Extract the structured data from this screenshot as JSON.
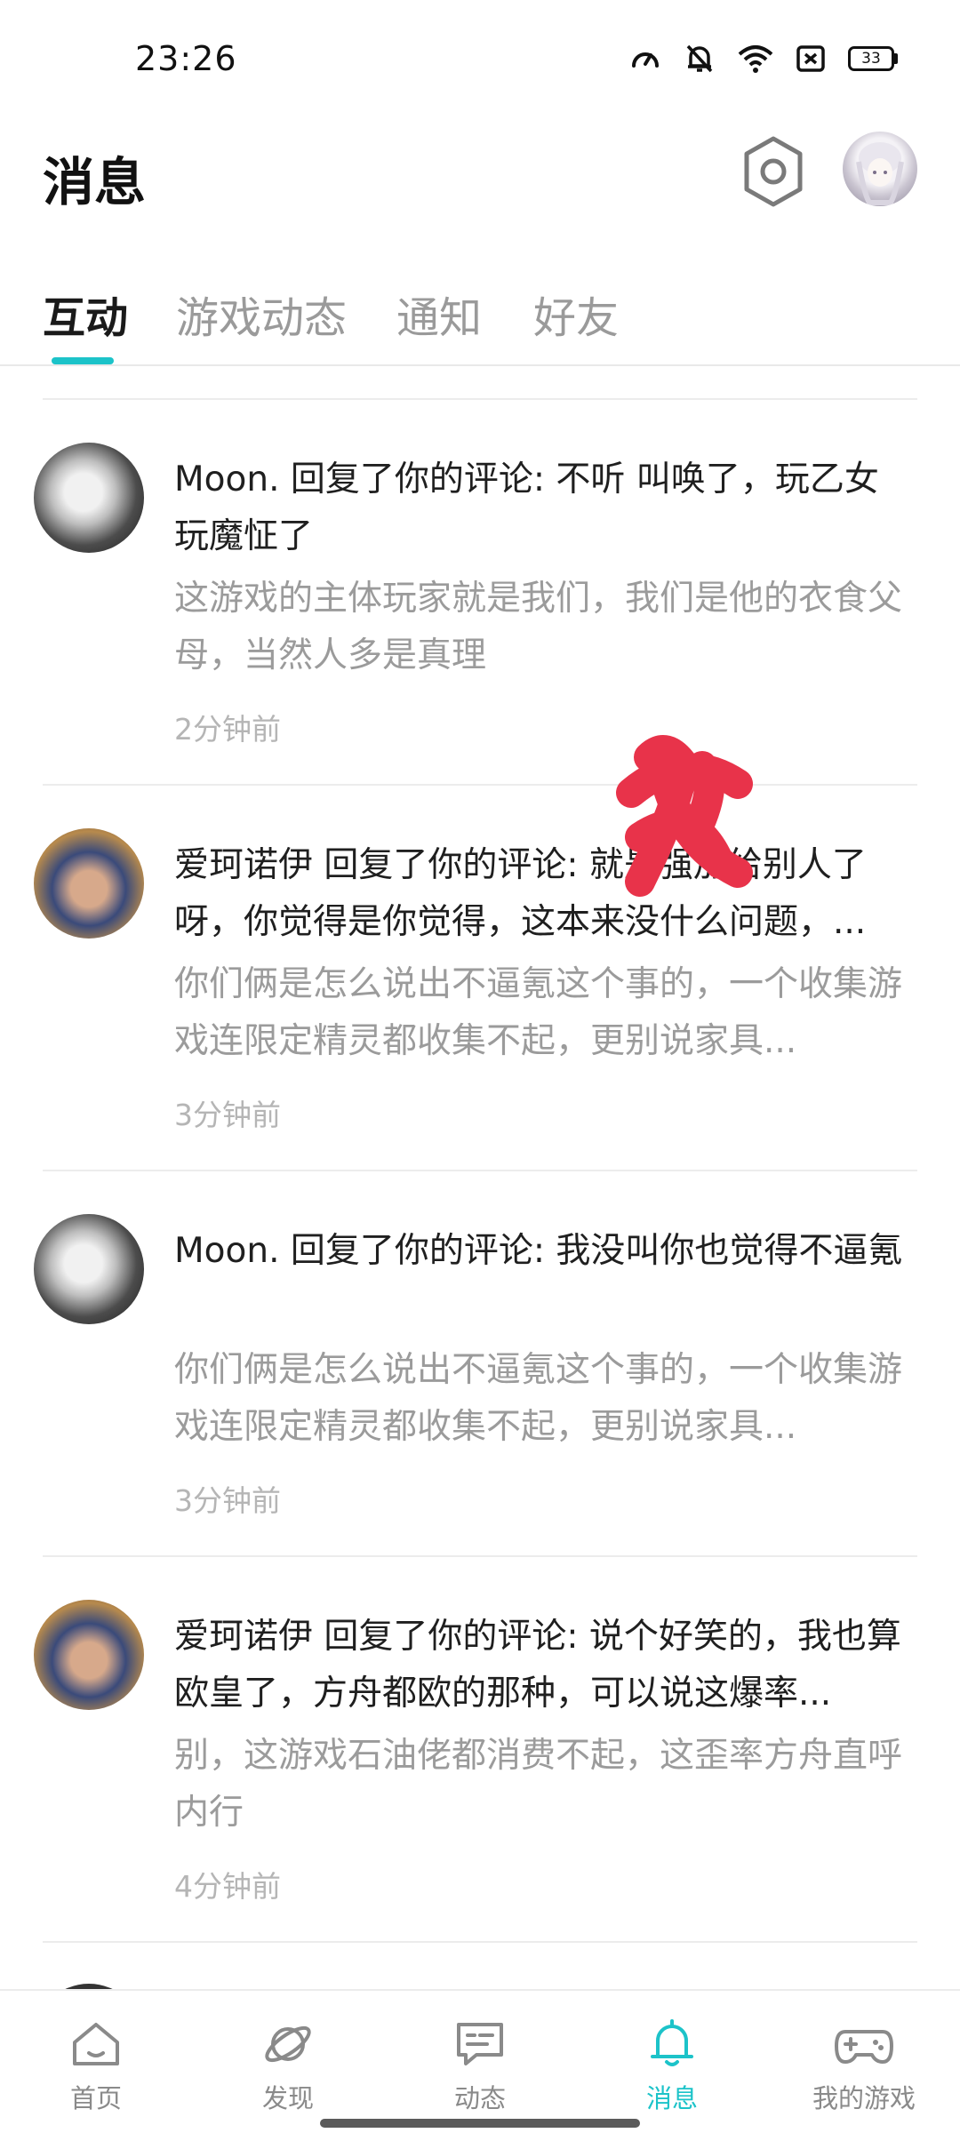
{
  "status_bar": {
    "time": "23:26",
    "battery": "33",
    "icons": [
      "data-speed-icon",
      "mute-icon",
      "wifi-icon",
      "sim-off-icon",
      "battery-icon"
    ]
  },
  "header": {
    "title": "消息",
    "settings_icon": "settings-hexagon-icon",
    "avatar_icon": "user-avatar"
  },
  "tabs": [
    {
      "label": "互动",
      "active": true
    },
    {
      "label": "游戏动态",
      "active": false
    },
    {
      "label": "通知",
      "active": false
    },
    {
      "label": "好友",
      "active": false
    }
  ],
  "messages": [
    {
      "user": "Moon.",
      "title": "Moon. 回复了你的评论: 不听  叫唤了，玩乙女玩魔怔了",
      "quote": "这游戏的主体玩家就是我们，我们是他的衣食父母，当然人多是真理",
      "time": "2分钟前"
    },
    {
      "user": "爱珂诺伊",
      "title": "爱珂诺伊 回复了你的评论: 就是强加给别人了呀，你觉得是你觉得，这本来没什么问题，...",
      "quote": "你们俩是怎么说出不逼氪这个事的，一个收集游戏连限定精灵都收集不起，更别说家具...",
      "time": "3分钟前"
    },
    {
      "user": "Moon.",
      "title": "Moon. 回复了你的评论: 我没叫你也觉得不逼氪",
      "quote": "你们俩是怎么说出不逼氪这个事的，一个收集游戏连限定精灵都收集不起，更别说家具...",
      "time": "3分钟前"
    },
    {
      "user": "爱珂诺伊",
      "title": "爱珂诺伊 回复了你的评论: 说个好笑的，我也算欧皇了，方舟都欧的那种，可以说这爆率...",
      "quote": "别，这游戏石油佬都消费不起，这歪率方舟直呼内行",
      "time": "4分钟前"
    }
  ],
  "bottom_nav": [
    {
      "label": "首页",
      "icon": "home-icon",
      "active": false
    },
    {
      "label": "发现",
      "icon": "planet-icon",
      "active": false
    },
    {
      "label": "动态",
      "icon": "chat-bubble-icon",
      "active": false
    },
    {
      "label": "消息",
      "icon": "bell-icon",
      "active": true
    },
    {
      "label": "我的游戏",
      "icon": "gamepad-icon",
      "active": false
    }
  ],
  "colors": {
    "accent": "#1cc3c9",
    "scribble": "#e8334a",
    "muted_text": "#9b9b9b"
  }
}
